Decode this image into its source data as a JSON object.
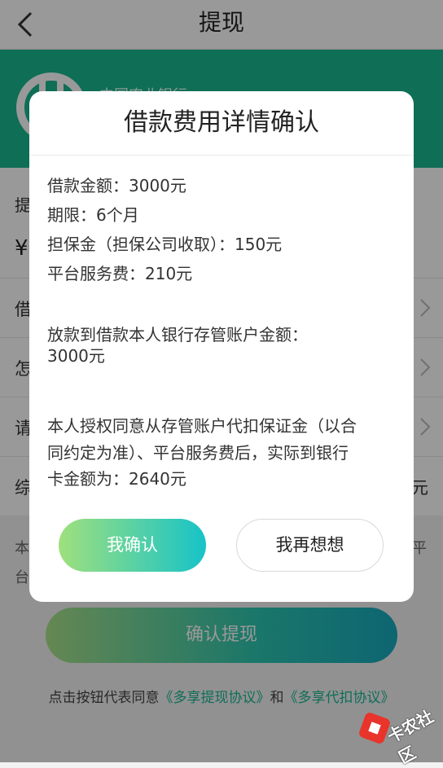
{
  "header": {
    "title": "提现"
  },
  "bank": {
    "name": "中国农业银行"
  },
  "withdraw": {
    "label": "提",
    "currency_symbol": "¥"
  },
  "rows": [
    {
      "label": "借",
      "has_chevron": true
    },
    {
      "label": "怎",
      "has_chevron": true
    },
    {
      "label": "请",
      "has_chevron": true
    },
    {
      "label": "综",
      "value": "元"
    }
  ],
  "note": {
    "line1": "本",
    "line1_end": "平",
    "line2": "台"
  },
  "submit": {
    "label": "确认提现"
  },
  "agreement": {
    "prefix": "点击按钮代表同意",
    "link1": "《多享提现协议》",
    "and": "和",
    "link2": "《多享代扣协议》"
  },
  "watermark": {
    "text": "卡农社区"
  },
  "dialog": {
    "title": "借款费用详情确认",
    "lines": [
      "借款金额：3000元",
      "期限：6个月",
      "担保金（担保公司收取）：150元",
      "平台服务费：210元"
    ],
    "disbursement": [
      "放款到借款本人银行存管账户金额：",
      "3000元"
    ],
    "authorization": [
      "本人授权同意从存管账户代扣保证金（以合",
      "同约定为准）、平台服务费后，实际到银行",
      "卡金额为：2640元"
    ],
    "confirm_label": "我确认",
    "rethink_label": "我再想想"
  },
  "colors": {
    "brand_green": "#18b78f",
    "button_gradient_start": "#9fe07d",
    "button_gradient_end": "#17c3c8"
  }
}
